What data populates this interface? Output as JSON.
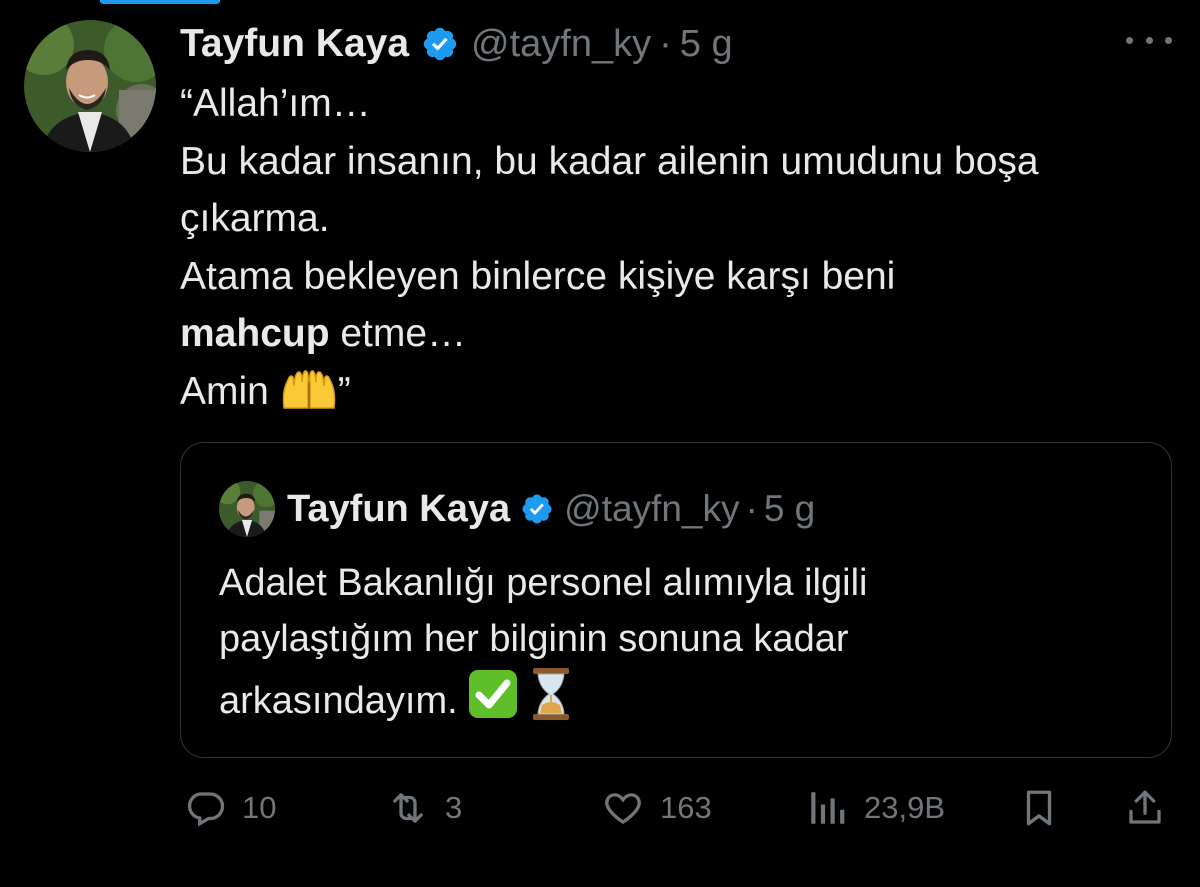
{
  "author": {
    "name": "Tayfun Kaya",
    "handle": "@tayfn_ky",
    "separator": "·",
    "time": "5 g",
    "verified_icon": "verified-badge-icon"
  },
  "tweet": {
    "lines": [
      "“Allah’ım…",
      "Bu kadar insanın, bu kadar ailenin umudunu boşa",
      "çıkarma.",
      "Atama bekleyen binlerce kişiye karşı beni"
    ],
    "bold_word": "mahcup",
    "bold_line_rest": " etme…",
    "last_line_text": "Amin ",
    "last_line_emoji": "raising-hands-emoji",
    "last_line_end": "”"
  },
  "quoted": {
    "name": "Tayfun Kaya",
    "handle": "@tayfn_ky",
    "separator": "·",
    "time": "5 g",
    "lines": [
      "Adalet Bakanlığı personel alımıyla ilgili",
      "paylaştığım her bilginin sonuna kadar"
    ],
    "last_line_text": "arkasındayım. ",
    "emojis": [
      "check-mark-button-emoji",
      "hourglass-emoji"
    ]
  },
  "actions": {
    "replies": "10",
    "retweets": "3",
    "likes": "163",
    "views": "23,9B"
  },
  "colors": {
    "background": "#000000",
    "text": "#e7e9ea",
    "muted": "#71767b",
    "accent": "#1d9bf0",
    "border": "#2f3336"
  }
}
